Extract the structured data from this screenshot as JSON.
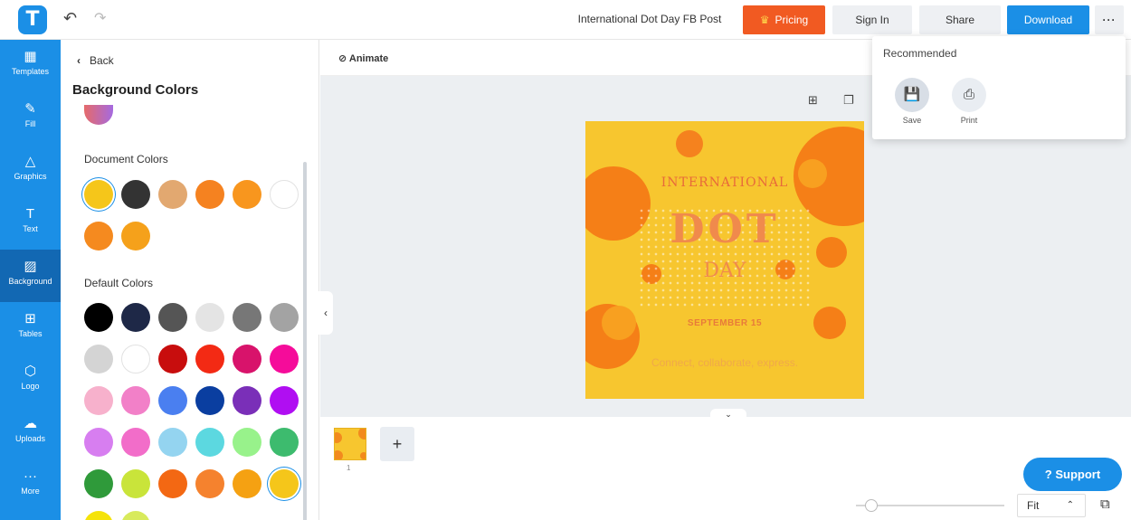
{
  "topbar": {
    "logo_letter": "T",
    "undo_icon": "↶",
    "redo_icon": "↷",
    "document_title": "International Dot Day FB Post",
    "pricing_label": "Pricing",
    "pricing_icon": "♛",
    "signin_label": "Sign In",
    "share_label": "Share",
    "download_label": "Download",
    "more_label": "···"
  },
  "rail": {
    "items": [
      {
        "label": "Templates",
        "icon": "▦"
      },
      {
        "label": "Fill",
        "icon": "✎"
      },
      {
        "label": "Graphics",
        "icon": "△"
      },
      {
        "label": "Text",
        "icon": "T"
      },
      {
        "label": "Background",
        "icon": "▨"
      },
      {
        "label": "Tables",
        "icon": "⊞"
      },
      {
        "label": "Logo",
        "icon": "⬡"
      },
      {
        "label": "Uploads",
        "icon": "☁"
      },
      {
        "label": "More",
        "icon": "···"
      }
    ],
    "active": "Background"
  },
  "panel": {
    "back_label": "Back",
    "back_icon": "‹",
    "title": "Background Colors",
    "document_colors_label": "Document Colors",
    "default_colors_label": "Default Colors",
    "document_colors": [
      "#f5c61a",
      "#333333",
      "#e2a870",
      "#f58220",
      "#f8961e",
      "#ffffff",
      "#f58a1f",
      "#f5a11b"
    ],
    "default_colors": [
      "#000000",
      "#1e2847",
      "#555555",
      "#e4e4e4",
      "#777777",
      "#a3a3a3",
      "#d4d4d4",
      "#ffffff",
      "#c80d0d",
      "#f32a14",
      "#d8136b",
      "#f50c9a",
      "#f7b1cc",
      "#f280c8",
      "#4a7ff0",
      "#0a3ea0",
      "#7a2fb8",
      "#b00ef2",
      "#d77ef0",
      "#f26dc9",
      "#94d4f0",
      "#5cd8e0",
      "#98f28b",
      "#3dbb6e",
      "#2f9a3a",
      "#c9e43a",
      "#f36813",
      "#f5822e",
      "#f5a112",
      "#f5c61a",
      "#f5e30a",
      "#d8ea5c"
    ]
  },
  "editor": {
    "animate_label": "Animate",
    "animate_icon": "⊘",
    "add_element_icon": "⊞",
    "duplicate_icon": "❐",
    "collapse_icon": "‹",
    "expand_icon": "⌄"
  },
  "design": {
    "line1": "INTERNATIONAL",
    "line2": "DOT",
    "line3": "DAY",
    "date": "SEPTEMBER 15",
    "tagline": "Connect, collaborate, express.",
    "background_color": "#f7c62f",
    "accent_color": "#f28a1e"
  },
  "popover": {
    "title": "Recommended",
    "save_label": "Save",
    "save_icon": "💾",
    "print_label": "Print",
    "print_icon": "⎙"
  },
  "bottom": {
    "page_number": "1",
    "add_page_icon": "+",
    "support_label": "Support",
    "support_icon": "?",
    "zoom_value": "Fit",
    "zoom_caret": "⌃",
    "pages_icon": "⧉"
  },
  "colors": {
    "brand_blue": "#1b8fe6",
    "pricing_orange": "#f15a22",
    "rail_active": "#1268b3"
  }
}
